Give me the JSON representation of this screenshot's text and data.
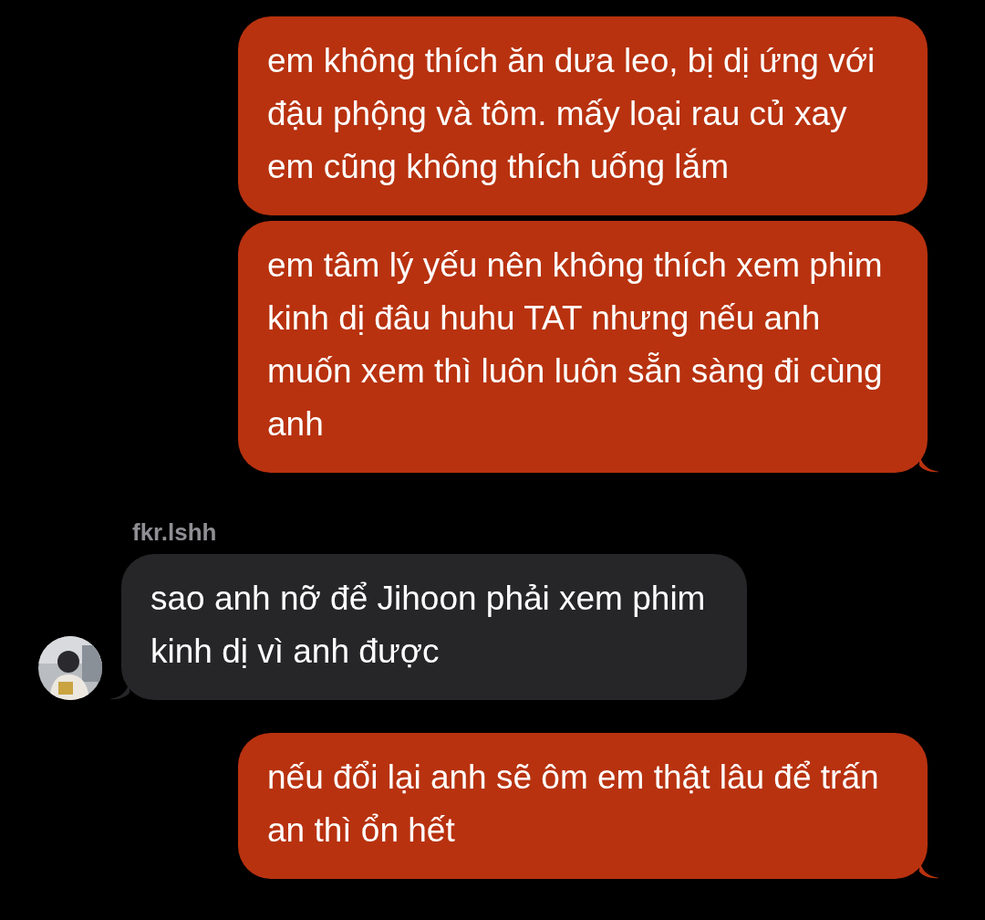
{
  "messages": [
    {
      "kind": "outgoing",
      "tail": false,
      "text": "em không thích ăn dưa leo, bị dị ứng với đậu phộng và tôm. mấy loại rau củ xay em cũng không thích uống lắm"
    },
    {
      "kind": "outgoing",
      "tail": true,
      "text": "em tâm lý yếu nên không thích xem phim kinh dị đâu huhu TAT nhưng nếu anh muốn xem thì luôn luôn sẵn sàng đi cùng anh"
    },
    {
      "kind": "incoming",
      "tail": true,
      "sender": "fkr.lshh",
      "text": "sao anh nỡ để Jihoon phải xem phim kinh dị vì anh được"
    },
    {
      "kind": "outgoing",
      "tail": true,
      "text": "nếu đổi lại anh sẽ ôm em thật lâu để trấn an thì ổn hết"
    }
  ]
}
